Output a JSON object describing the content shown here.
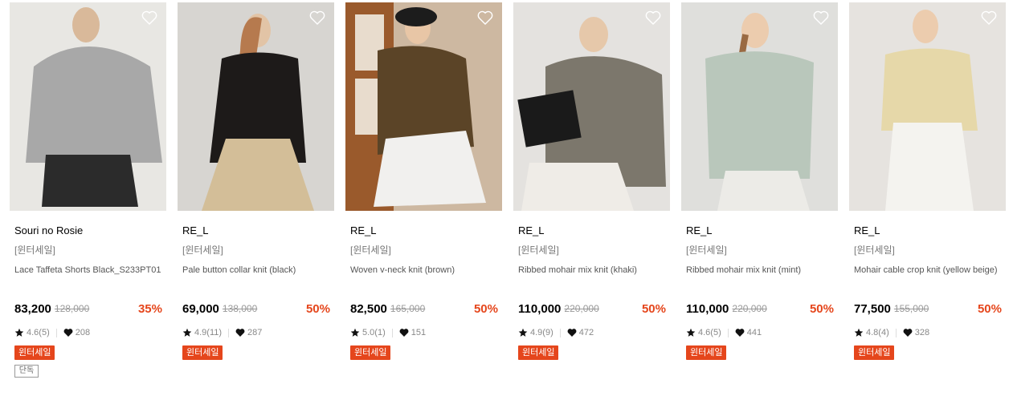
{
  "products": [
    {
      "brand": "Souri no Rosie",
      "tag": "[윈터세일]",
      "title": "Lace Taffeta Shorts Black_S233PT01",
      "price": "83,200",
      "original_price": "128,000",
      "discount": "35%",
      "rating": "4.6(5)",
      "likes": "208",
      "badge": "윈터세일",
      "extra_badge": "단독",
      "photo": {
        "bg": "#e8e7e3",
        "top": "#a8a8a8",
        "bottom": "#2b2b2b"
      }
    },
    {
      "brand": "RE_L",
      "tag": "[윈터세일]",
      "title": "Pale button collar knit (black)",
      "price": "69,000",
      "original_price": "138,000",
      "discount": "50%",
      "rating": "4.9(11)",
      "likes": "287",
      "badge": "윈터세일",
      "photo": {
        "bg": "#d7d5d1",
        "top": "#1d1a19",
        "bottom": "#d3be98"
      }
    },
    {
      "brand": "RE_L",
      "tag": "[윈터세일]",
      "title": "Woven v-neck knit (brown)",
      "price": "82,500",
      "original_price": "165,000",
      "discount": "50%",
      "rating": "5.0(1)",
      "likes": "151",
      "badge": "윈터세일",
      "photo": {
        "bg": "#cdb8a1",
        "top": "#5b4427",
        "bottom": "#f1f0ee"
      }
    },
    {
      "brand": "RE_L",
      "tag": "[윈터세일]",
      "title": "Ribbed mohair mix knit (khaki)",
      "price": "110,000",
      "original_price": "220,000",
      "discount": "50%",
      "rating": "4.9(9)",
      "likes": "472",
      "badge": "윈터세일",
      "photo": {
        "bg": "#e4e2df",
        "top": "#7c776c",
        "bottom": "#efece7"
      }
    },
    {
      "brand": "RE_L",
      "tag": "[윈터세일]",
      "title": "Ribbed mohair mix knit (mint)",
      "price": "110,000",
      "original_price": "220,000",
      "discount": "50%",
      "rating": "4.6(5)",
      "likes": "441",
      "badge": "윈터세일",
      "photo": {
        "bg": "#dfdfdc",
        "top": "#b9c7bb",
        "bottom": "#ecebe7"
      }
    },
    {
      "brand": "RE_L",
      "tag": "[윈터세일]",
      "title": "Mohair cable crop knit (yellow beige)",
      "price": "77,500",
      "original_price": "155,000",
      "discount": "50%",
      "rating": "4.8(4)",
      "likes": "328",
      "badge": "윈터세일",
      "photo": {
        "bg": "#e6e3df",
        "top": "#e6d8a9",
        "bottom": "#f4f3ef"
      }
    }
  ],
  "colors": {
    "accent": "#e5461c",
    "muted": "#888888"
  },
  "icons": {
    "wishlist": "heart-outline-icon",
    "rating": "star-icon",
    "likes": "heart-icon"
  }
}
